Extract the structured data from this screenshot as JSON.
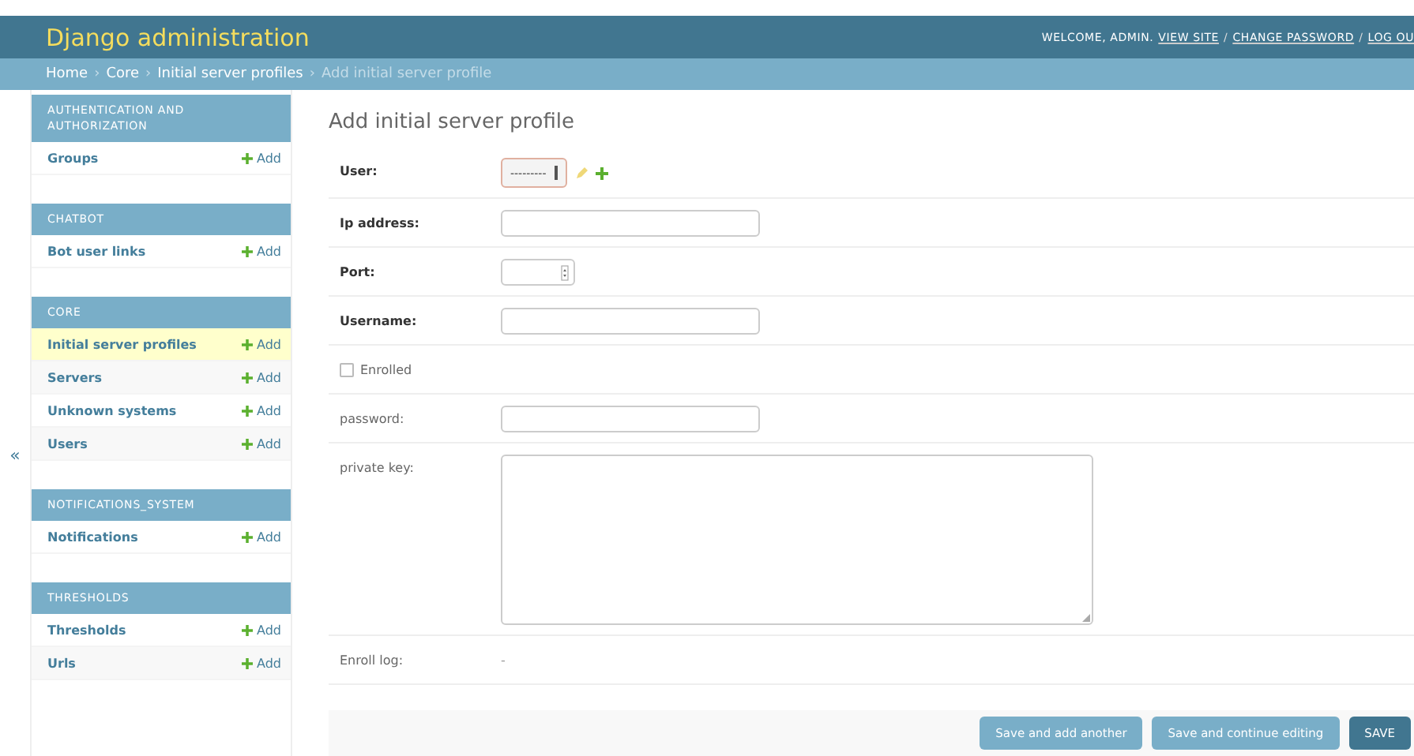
{
  "header": {
    "site_title": "Django administration",
    "welcome": "WELCOME, ADMIN.",
    "items": [
      {
        "kind": "link",
        "text": "VIEW SITE"
      },
      {
        "kind": "separator",
        "text": "/"
      },
      {
        "kind": "link",
        "text": "CHANGE PASSWORD"
      },
      {
        "kind": "separator",
        "text": "/"
      },
      {
        "kind": "link",
        "text": "LOG OU"
      }
    ]
  },
  "breadcrumbs": {
    "items": [
      {
        "kind": "link",
        "text": "Home"
      },
      {
        "kind": "separator",
        "text": "›"
      },
      {
        "kind": "link",
        "text": "Core"
      },
      {
        "kind": "separator",
        "text": "›"
      },
      {
        "kind": "link",
        "text": "Initial server profiles"
      },
      {
        "kind": "separator",
        "text": "›"
      },
      {
        "kind": "current",
        "text": "Add initial server profile"
      }
    ]
  },
  "sidebar": {
    "collapse_icon": "«",
    "modules": [
      {
        "caption": "AUTHENTICATION AND AUTHORIZATION",
        "items": [
          {
            "label": "Groups",
            "add": "Add",
            "selected": false
          }
        ]
      },
      {
        "caption": "CHATBOT",
        "items": [
          {
            "label": "Bot user links",
            "add": "Add",
            "selected": false
          }
        ]
      },
      {
        "caption": "CORE",
        "items": [
          {
            "label": "Initial server profiles",
            "add": "Add",
            "selected": true
          },
          {
            "label": "Servers",
            "add": "Add",
            "selected": false
          },
          {
            "label": "Unknown systems",
            "add": "Add",
            "selected": false
          },
          {
            "label": "Users",
            "add": "Add",
            "selected": false
          }
        ]
      },
      {
        "caption": "NOTIFICATIONS_SYSTEM",
        "items": [
          {
            "label": "Notifications",
            "add": "Add",
            "selected": false
          }
        ]
      },
      {
        "caption": "THRESHOLDS",
        "items": [
          {
            "label": "Thresholds",
            "add": "Add",
            "selected": false
          },
          {
            "label": "Urls",
            "add": "Add",
            "selected": false
          }
        ]
      }
    ]
  },
  "form": {
    "title": "Add initial server profile",
    "fields": [
      {
        "kind": "select",
        "label": "User:",
        "required": true,
        "value": "---------"
      },
      {
        "kind": "text",
        "label": "Ip address:",
        "required": true
      },
      {
        "kind": "number",
        "label": "Port:",
        "required": true
      },
      {
        "kind": "text",
        "label": "Username:",
        "required": true
      },
      {
        "kind": "checkbox",
        "label": "Enrolled",
        "required": false,
        "checked": false
      },
      {
        "kind": "text",
        "label": "password:",
        "required": false
      },
      {
        "kind": "textarea",
        "label": "private key:",
        "required": false
      },
      {
        "kind": "readonly",
        "label": "Enroll log:",
        "required": false,
        "value": "-"
      }
    ]
  },
  "buttons": [
    {
      "label": "Save and add another",
      "kind": "secondary"
    },
    {
      "label": "Save and continue editing",
      "kind": "secondary"
    },
    {
      "label": "SAVE",
      "kind": "primary"
    }
  ]
}
